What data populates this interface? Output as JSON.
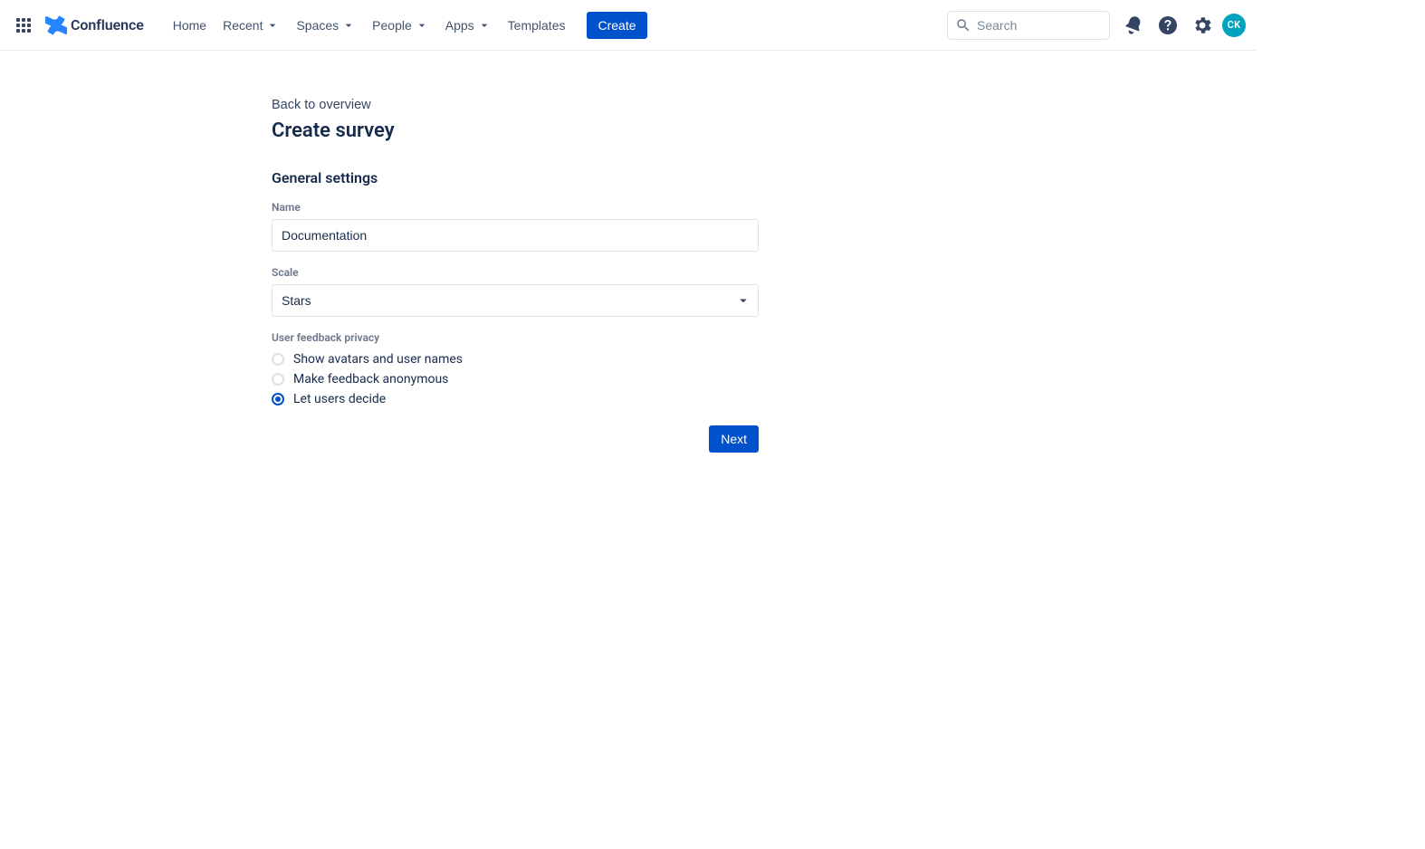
{
  "brand": {
    "name": "Confluence"
  },
  "nav": {
    "home": "Home",
    "recent": "Recent",
    "spaces": "Spaces",
    "people": "People",
    "apps": "Apps",
    "templates": "Templates",
    "create": "Create"
  },
  "search": {
    "placeholder": "Search",
    "value": ""
  },
  "avatar": {
    "initials": "CK"
  },
  "page": {
    "back": "Back to overview",
    "title": "Create survey",
    "section_general": "General settings",
    "name_label": "Name",
    "name_value": "Documentation",
    "scale_label": "Scale",
    "scale_value": "Stars",
    "privacy_label": "User feedback privacy",
    "privacy_options": {
      "show": "Show avatars and user names",
      "anon": "Make feedback anonymous",
      "decide": "Let users decide"
    },
    "privacy_selected": "decide",
    "next": "Next"
  }
}
